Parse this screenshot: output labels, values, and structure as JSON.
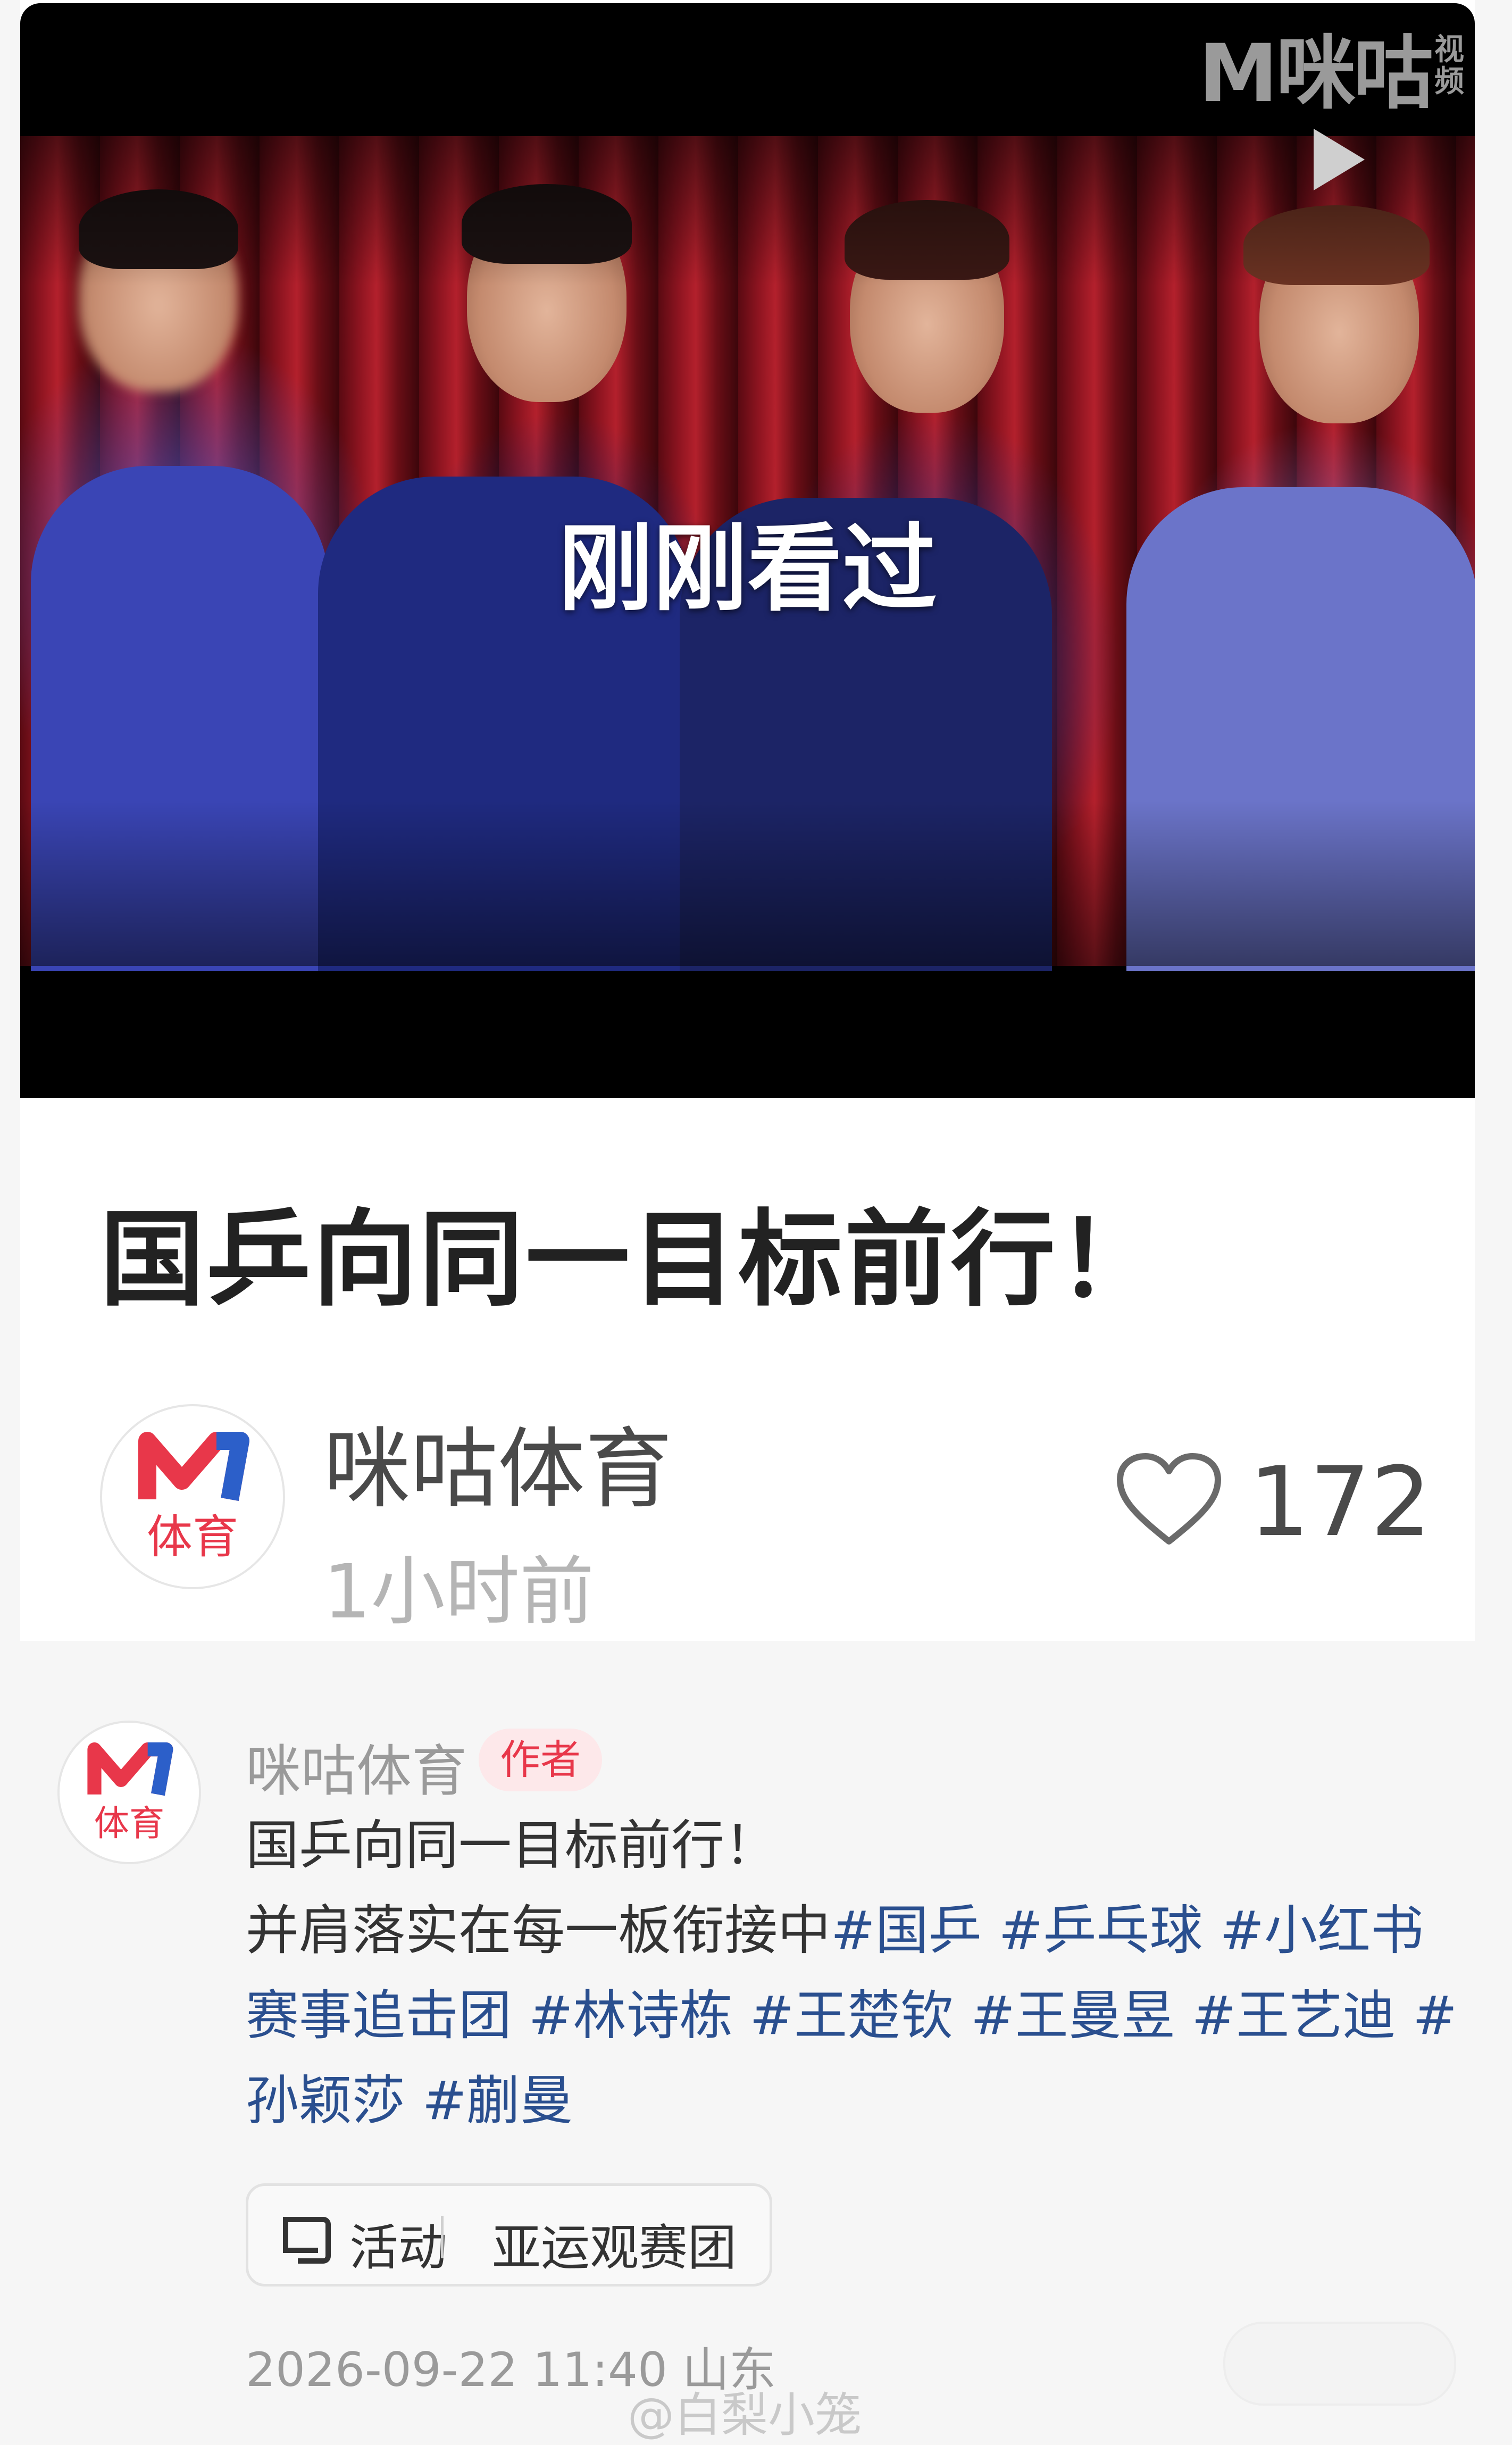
{
  "video": {
    "watermark": "M咪咕",
    "watermark_sub": "视频",
    "overlay_text": "刚刚看过",
    "play_icon": "play-icon"
  },
  "post": {
    "title": "国乒向同一目标前行！",
    "author": "咪咕体育",
    "time": "1小时前",
    "like_icon": "heart-outline-icon",
    "likes": "172"
  },
  "avatar": {
    "logo_text": "体育",
    "colors": {
      "red": "#e8374a",
      "blue": "#2c5fc9"
    }
  },
  "comment": {
    "author": "咪咕体育",
    "badge": "作者",
    "line1": "国乒向同一目标前行！",
    "line2_text": "并肩落实在每一板衔接中",
    "tags_line2": [
      "#国乒",
      "#乒乓球",
      "#小红书"
    ],
    "line3_first": "赛事追击团",
    "tags_line3": [
      "#林诗栋",
      "#王楚钦",
      "#王曼昱",
      "#王艺迪",
      "#"
    ],
    "line4_first": "孙颖莎",
    "tags_line4": [
      "#蒯曼"
    ],
    "activity_label": "活动",
    "activity_name": "亚运观赛团",
    "date": "2026-09-22 11:40",
    "location": "山东"
  },
  "source_watermark": "@白梨小笼",
  "colors": {
    "tag": "#2a4f8f",
    "badge_text": "#e8374a",
    "badge_bg": "#fde8ea"
  }
}
